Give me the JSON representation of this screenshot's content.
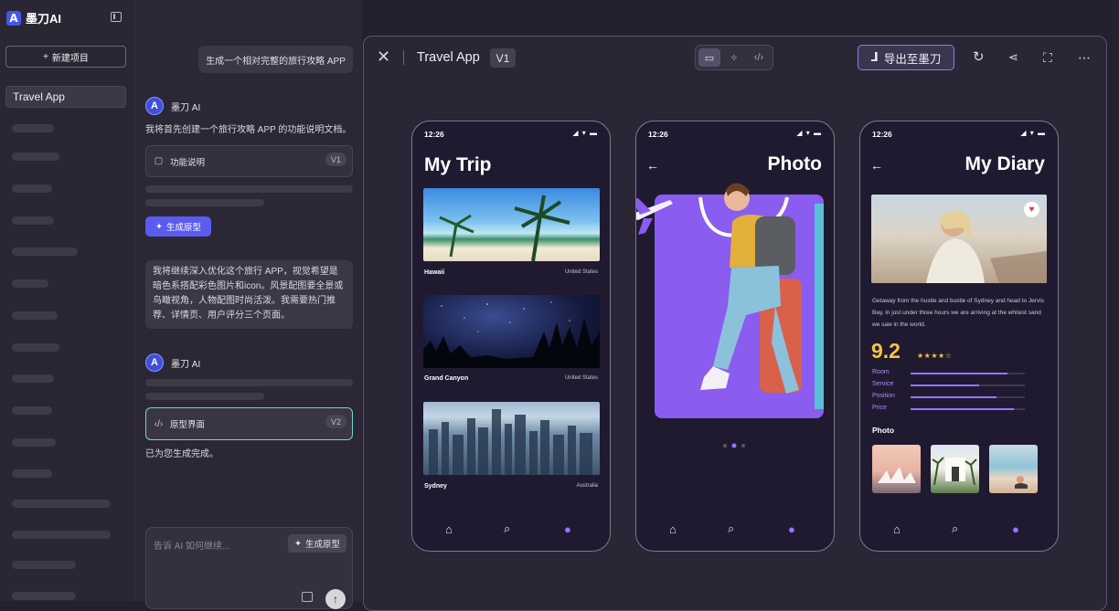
{
  "app": {
    "logo_letter": "A",
    "name": "墨刀AI"
  },
  "sidebar": {
    "new_project": "新建项目",
    "current_project": "Travel App"
  },
  "chat": {
    "user_msg_1": "生成一个相对完整的旅行攻略 APP",
    "ai_name": "墨刀 AI",
    "ai_msg_1": "我将首先创建一个旅行攻略 APP 的功能说明文档。",
    "doc_card": {
      "label": "功能说明",
      "version": "V1"
    },
    "generate_prototype": "生成原型",
    "user_msg_2": "我将继续深入优化这个旅行 APP，视觉希望是暗色系搭配彩色图片和icon。风景配图要全景或鸟瞰视角，人物配图时尚活泼。我需要热门推荐、详情页、用户评分三个页面。",
    "ai_name_2": "墨刀 AI",
    "proto_card": {
      "label": "原型界面",
      "version": "V2"
    },
    "done_msg": "已为您生成完成。",
    "input_placeholder": "告诉 AI 如何继续...",
    "input_generate": "生成原型"
  },
  "preview": {
    "title": "Travel App",
    "version": "V1",
    "export_label": "导出至墨刀"
  },
  "phones": {
    "status_time": "12:26",
    "trip": {
      "title": "My Trip",
      "items": [
        {
          "name": "Hawaii",
          "country": "United States"
        },
        {
          "name": "Grand Canyon",
          "country": "United States"
        },
        {
          "name": "Sydney",
          "country": "Australia"
        }
      ]
    },
    "photo": {
      "title": "Photo"
    },
    "diary": {
      "title": "My Diary",
      "text": "Getaway from the hustle and bustle of Sydney and head to Jervis Bay, in just under three hours we are arriving at the whitest sand we saw in the world.",
      "score": "9.2",
      "ratings": [
        {
          "label": "Room",
          "value": 0.85
        },
        {
          "label": "Service",
          "value": 0.6
        },
        {
          "label": "Position",
          "value": 0.75
        },
        {
          "label": "Price",
          "value": 0.9
        }
      ],
      "photo_heading": "Photo"
    }
  },
  "colors": {
    "accent": "#5a5cf0",
    "purple": "#9b73ff",
    "score": "#f5c542"
  }
}
